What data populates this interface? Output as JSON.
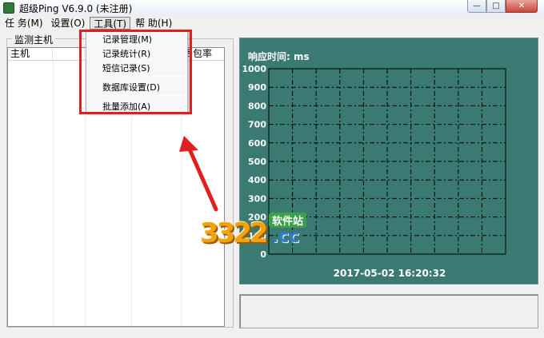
{
  "window": {
    "title": "超级Ping V6.9.0 (未注册)",
    "min_icon": "minimize-icon",
    "max_icon": "maximize-icon",
    "close_icon": "close-icon"
  },
  "menubar": {
    "items": [
      "任 务(M)",
      "设置(O)",
      "工具(T)",
      "帮 助(H)"
    ],
    "active_index": 2
  },
  "dropdown": {
    "items": [
      "记录管理(M)",
      "记录统计(R)",
      "短信记录(S)",
      "数据库设置(D)",
      "批量添加(A)"
    ]
  },
  "hosts_group": {
    "title": "监测主机",
    "columns": [
      "主机",
      "",
      "",
      "",
      "丢包率"
    ]
  },
  "chart": {
    "title": "响应时间: ms",
    "y_ticks": [
      "1000",
      "900",
      "800",
      "700",
      "600",
      "500",
      "400",
      "300",
      "200",
      "100",
      "0"
    ],
    "timestamp": "2017-05-02   16:20:32",
    "background": "#3a7a72",
    "grid_color": "#000000"
  },
  "watermark": {
    "number": "3322",
    "suffix": ".cc",
    "label": "软件站"
  },
  "annotation": {
    "box_color": "#e02020",
    "arrow_color": "#e02020"
  }
}
